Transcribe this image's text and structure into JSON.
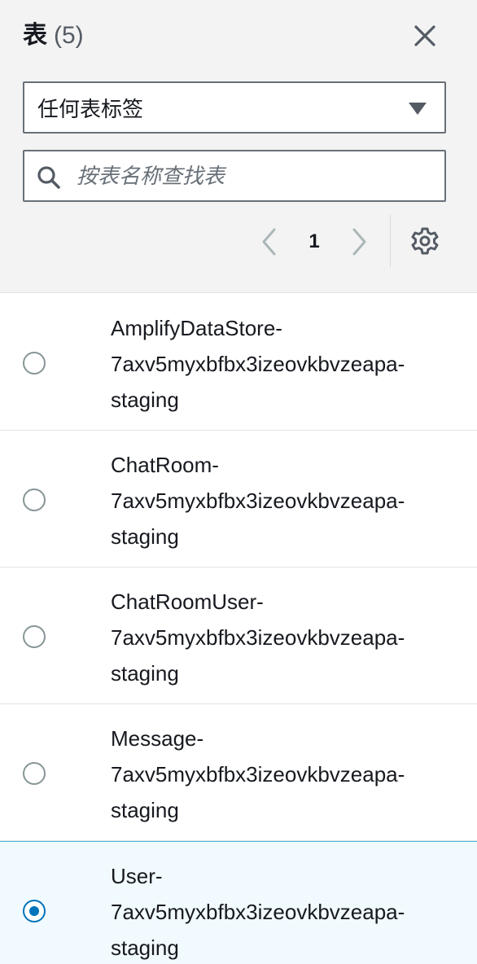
{
  "header": {
    "title": "表",
    "count": "(5)",
    "close_icon": "close-icon"
  },
  "filter": {
    "selected": "任何表标签"
  },
  "search": {
    "placeholder": "按表名称查找表",
    "value": ""
  },
  "pagination": {
    "current_page": "1"
  },
  "tables": [
    {
      "name": "AmplifyDataStore-\n7axv5myxbfbx3izeovkbvzeapa-\nstaging",
      "selected": false
    },
    {
      "name": "ChatRoom-\n7axv5myxbfbx3izeovkbvzeapa-\nstaging",
      "selected": false
    },
    {
      "name": "ChatRoomUser-\n7axv5myxbfbx3izeovkbvzeapa-\nstaging",
      "selected": false
    },
    {
      "name": "Message-\n7axv5myxbfbx3izeovkbvzeapa-\nstaging",
      "selected": false
    },
    {
      "name": "User-\n7axv5myxbfbx3izeovkbvzeapa-\nstaging",
      "selected": true
    }
  ],
  "colors": {
    "accent": "#0073bb",
    "selected_bg": "#f1faff",
    "header_bg": "#f3f3f3"
  }
}
